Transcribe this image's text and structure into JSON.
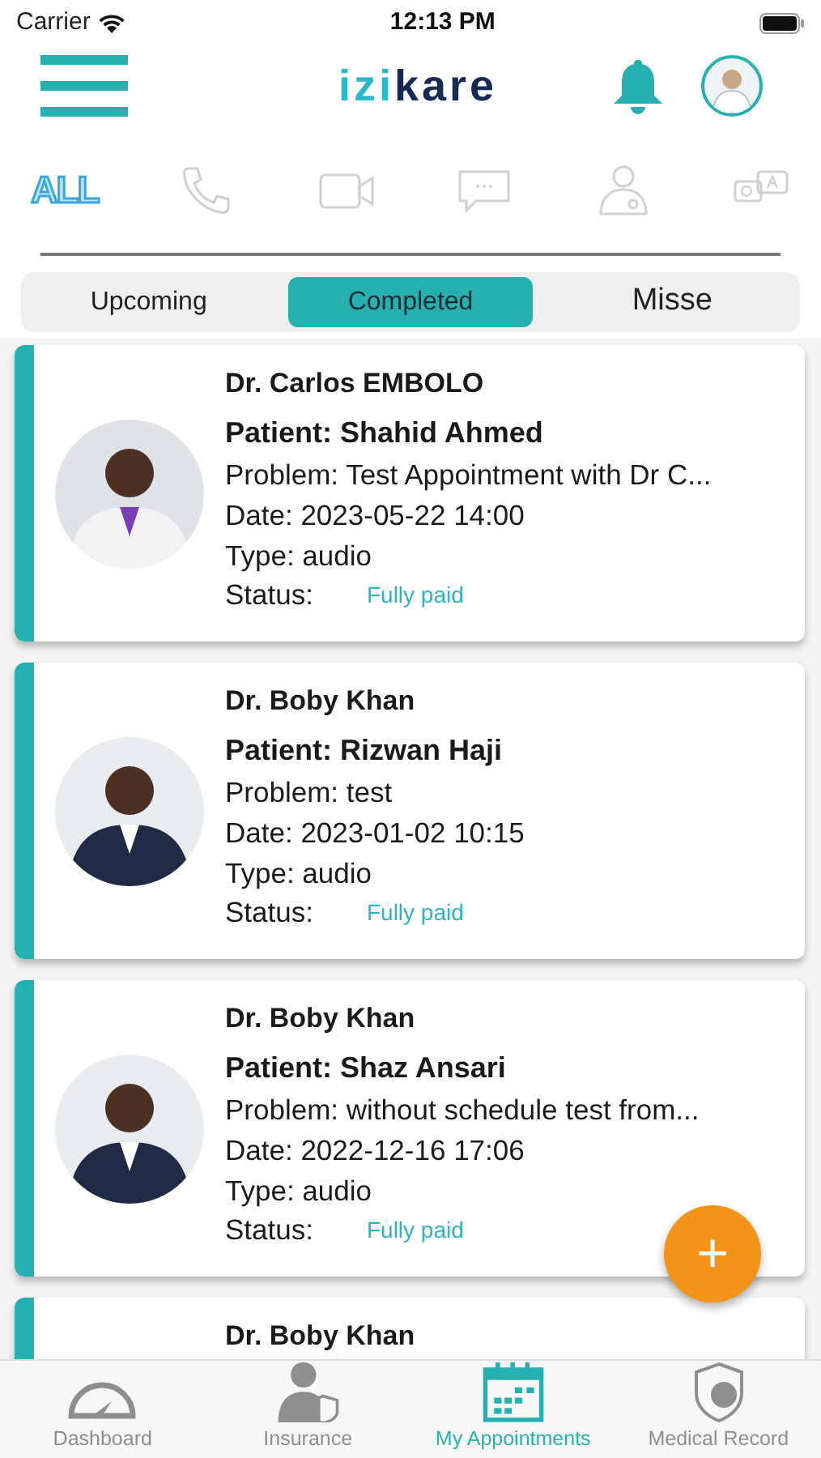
{
  "status_bar": {
    "carrier": "Carrier",
    "time": "12:13 PM"
  },
  "header": {
    "logo": [
      "izi",
      "kare"
    ]
  },
  "filters": [
    {
      "kind": "all",
      "label": "ALL",
      "selected": true
    },
    {
      "kind": "phone",
      "selected": false
    },
    {
      "kind": "video",
      "selected": false
    },
    {
      "kind": "chat",
      "selected": false
    },
    {
      "kind": "doctor",
      "selected": false
    },
    {
      "kind": "qa",
      "selected": false
    }
  ],
  "segments": [
    {
      "label": "Upcoming",
      "selected": false
    },
    {
      "label": "Completed",
      "selected": true
    },
    {
      "label": "Misse",
      "selected": false
    }
  ],
  "appointments": [
    {
      "doctor": "Dr. Carlos EMBOLO",
      "patient": "Patient: Shahid Ahmed",
      "problem": "Problem: Test Appointment with Dr C...",
      "date": "Date: 2023-05-22 14:00",
      "type": "Type: audio",
      "status_label": "Status:",
      "status": "Fully paid"
    },
    {
      "doctor": "Dr. Boby Khan",
      "patient": "Patient: Rizwan Haji",
      "problem": "Problem: test",
      "date": "Date: 2023-01-02 10:15",
      "type": "Type: audio",
      "status_label": "Status:",
      "status": "Fully paid"
    },
    {
      "doctor": "Dr. Boby Khan",
      "patient": "Patient: Shaz Ansari",
      "problem": "Problem: without schedule test from...",
      "date": "Date: 2022-12-16 17:06",
      "type": "Type: audio",
      "status_label": "Status:",
      "status": "Fully paid"
    },
    {
      "doctor": "Dr. Boby Khan"
    }
  ],
  "fab": {
    "label": "+"
  },
  "tab_bar": [
    {
      "kind": "dashboard",
      "label": "Dashboard",
      "selected": false
    },
    {
      "kind": "insurance",
      "label": "Insurance",
      "selected": false
    },
    {
      "kind": "appointments",
      "label": "My Appointments",
      "selected": true
    },
    {
      "kind": "record",
      "label": "Medical Record",
      "selected": false
    }
  ]
}
